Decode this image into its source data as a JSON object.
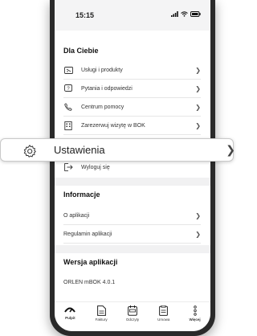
{
  "status": {
    "time": "15:15"
  },
  "sections": {
    "for_you": "Dla Ciebie",
    "info": "Informacje",
    "version": "Wersja aplikacji"
  },
  "menu": {
    "services": "Usługi i produkty",
    "questions": "Pytania i odpowiedzi",
    "help": "Centrum pomocy",
    "book": "Zarezerwuj wizytę w BOK",
    "logout": "Wyloguj się",
    "about": "O aplikacji",
    "terms": "Regulamin aplikacji",
    "version_value": "ORLEN mBOK 4.0.1"
  },
  "callout": {
    "label": "Ustawienia",
    "icon": "gear-icon"
  },
  "tabs": [
    "Pulpit",
    "Faktury",
    "Odczyty",
    "Umowa",
    "Więcej"
  ],
  "colors": {
    "accent": "#111111",
    "background": "#ffffff",
    "divider": "#e6e6e6"
  }
}
